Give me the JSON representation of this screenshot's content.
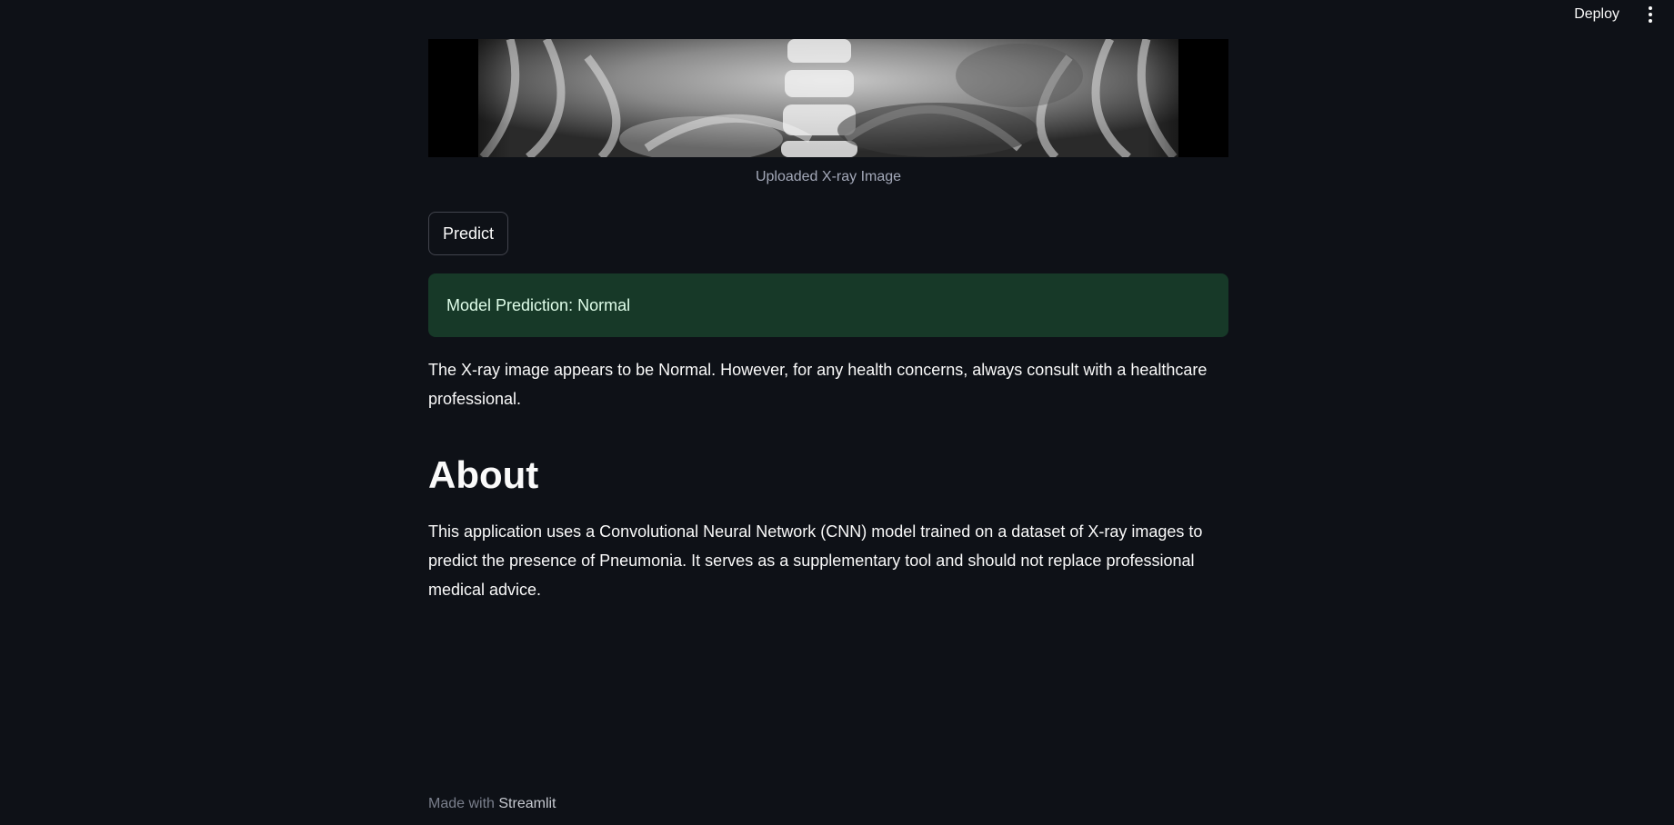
{
  "toolbar": {
    "deploy_label": "Deploy",
    "menu_icon": "vertical-ellipsis-icon"
  },
  "image": {
    "caption": "Uploaded X-ray Image"
  },
  "predict_button": {
    "label": "Predict"
  },
  "prediction_alert": {
    "text": "Model Prediction: Normal",
    "status_color": "#173928"
  },
  "result_text": "The X-ray image appears to be Normal. However, for any health concerns, always consult with a healthcare professional.",
  "about": {
    "heading": "About",
    "text": "This application uses a Convolutional Neural Network (CNN) model trained on a dataset of X-ray images to predict the presence of Pneumonia. It serves as a supplementary tool and should not replace professional medical advice."
  },
  "footer": {
    "prefix": "Made with",
    "brand": "Streamlit"
  }
}
